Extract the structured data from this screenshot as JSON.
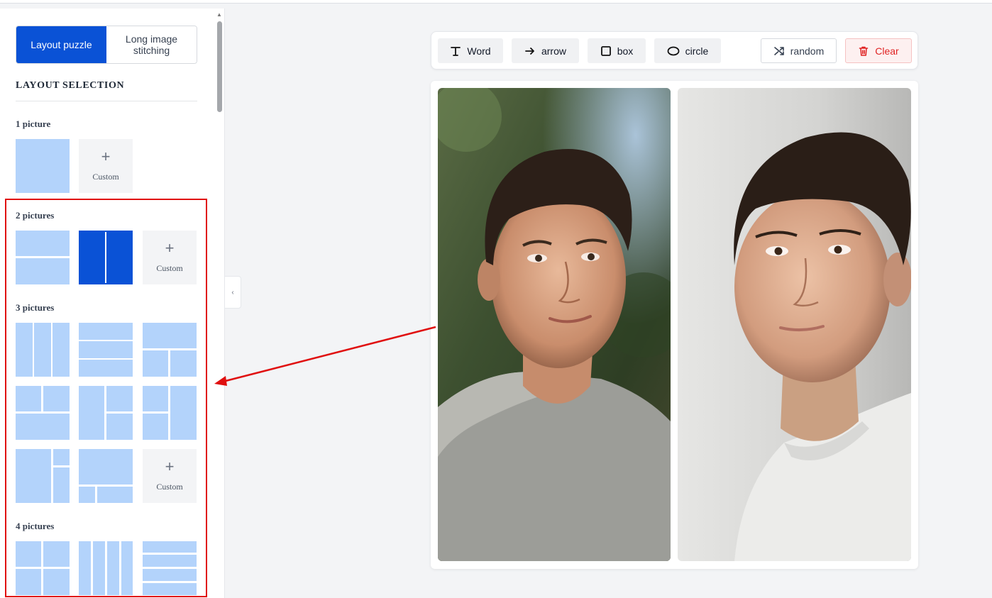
{
  "sidebar": {
    "tabs": [
      {
        "label": "Layout puzzle",
        "active": true
      },
      {
        "label": "Long image stitching",
        "active": false
      }
    ],
    "section_title": "LAYOUT SELECTION",
    "groups": [
      {
        "label": "1 picture"
      },
      {
        "label": "2 pictures"
      },
      {
        "label": "3 pictures"
      },
      {
        "label": "4 pictures"
      }
    ],
    "custom_label": "Custom",
    "plus_glyph": "+",
    "collapse_glyph": "‹"
  },
  "toolbar": {
    "word_label": "Word",
    "arrow_label": "arrow",
    "box_label": "box",
    "circle_label": "circle",
    "random_label": "random",
    "clear_label": "Clear"
  },
  "colors": {
    "accent": "#0a52d6",
    "tile": "#b3d3fb",
    "danger": "#e02424",
    "annotation": "#e01010"
  },
  "canvas": {
    "layout": "2 pictures side by side",
    "images": [
      {
        "subject": "young man portrait outdoors, grey t-shirt"
      },
      {
        "subject": "young man portrait studio, white t-shirt"
      }
    ]
  }
}
